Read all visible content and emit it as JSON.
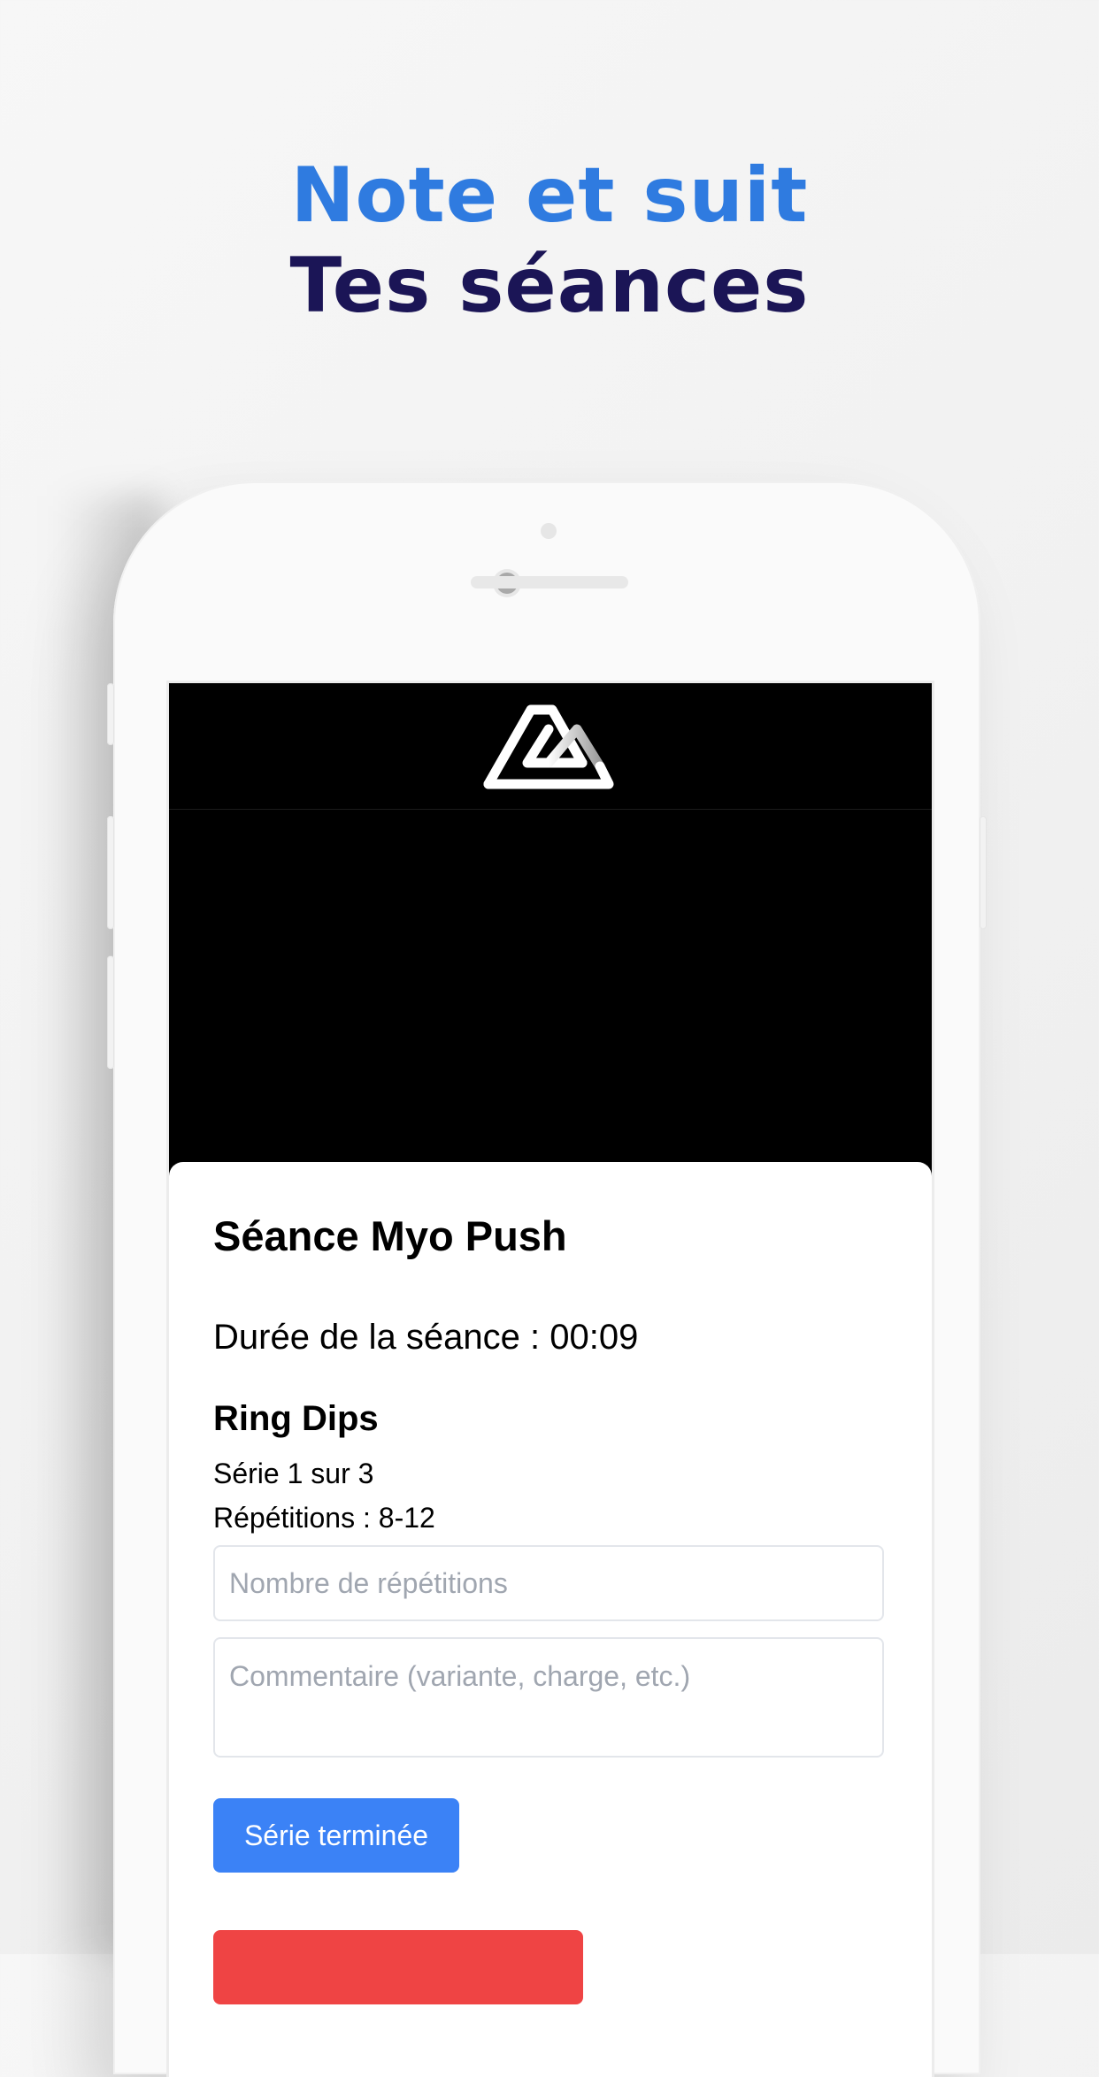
{
  "headline": {
    "line1": "Note et suit",
    "line2": "Tes séances"
  },
  "app": {
    "logo": "cm-mountain-logo"
  },
  "session": {
    "title": "Séance Myo Push",
    "duration_label": "Durée de la séance :",
    "duration_value": "00:09",
    "exercise_name": "Ring Dips",
    "series_text": "Série 1 sur 3",
    "reps_text": "Répétitions : 8-12"
  },
  "form": {
    "reps_placeholder": "Nombre de répétitions",
    "comment_placeholder": "Commentaire (variante, charge, etc.)",
    "done_button": "Série terminée",
    "red_button": ""
  },
  "colors": {
    "accent_blue": "#3b82f6",
    "headline_blue": "#2f7be0",
    "headline_navy": "#1b1556",
    "danger_red": "#ef4444"
  }
}
